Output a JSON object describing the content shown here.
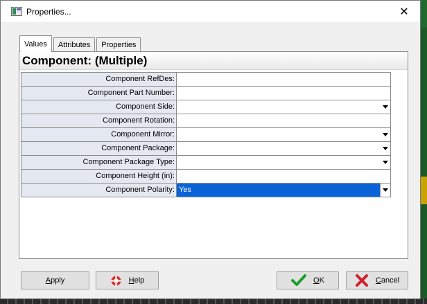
{
  "window": {
    "title": "Properties...",
    "close_glyph": "✕"
  },
  "tabs": [
    {
      "label": "Values",
      "active": true
    },
    {
      "label": "Attributes",
      "active": false
    },
    {
      "label": "Properties",
      "active": false
    }
  ],
  "panel": {
    "title": "Component: (Multiple)"
  },
  "properties": [
    {
      "label": "Component RefDes:",
      "value": "",
      "dropdown": false
    },
    {
      "label": "Component Part Number:",
      "value": "",
      "dropdown": false
    },
    {
      "label": "Component Side:",
      "value": "",
      "dropdown": true
    },
    {
      "label": "Component Rotation:",
      "value": "",
      "dropdown": false
    },
    {
      "label": "Component Mirror:",
      "value": "",
      "dropdown": true
    },
    {
      "label": "Component Package:",
      "value": "",
      "dropdown": true
    },
    {
      "label": "Component Package Type:",
      "value": "",
      "dropdown": true
    },
    {
      "label": "Component Height (in):",
      "value": "",
      "dropdown": false
    },
    {
      "label": "Component Polarity:",
      "value": "Yes",
      "dropdown": true,
      "selected": true
    }
  ],
  "buttons": {
    "apply": {
      "mnemonic": "A",
      "rest": "pply"
    },
    "help": {
      "mnemonic": "H",
      "rest": "elp"
    },
    "ok": {
      "mnemonic": "O",
      "rest": "K"
    },
    "cancel": {
      "mnemonic": "C",
      "rest": "ancel"
    }
  },
  "colors": {
    "selection": "#0a64d8",
    "label_bg": "#e4e8f0",
    "ok_check": "#1e9e2a",
    "cancel_x": "#d0202a",
    "help_ring": "#d9322b"
  }
}
